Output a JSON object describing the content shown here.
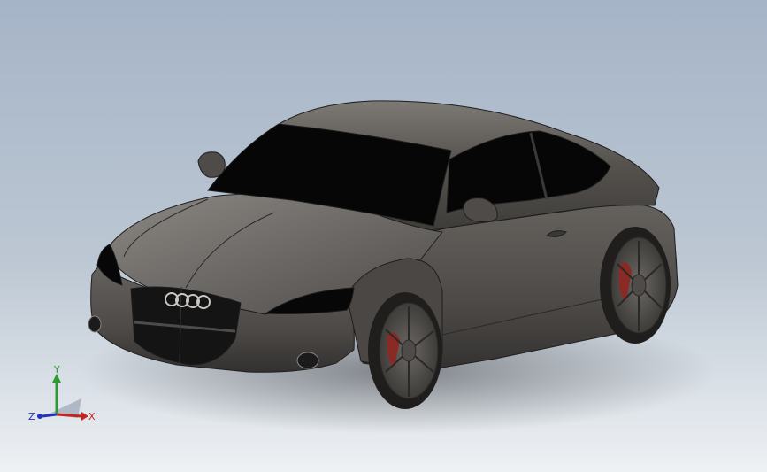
{
  "viewport": {
    "background_top": "#a5b4c7",
    "background_bottom": "#eef1f4"
  },
  "model": {
    "body_color": "#55524f",
    "glass_color": "#060606",
    "outline_color": "#1e1e1e",
    "brake_color": "#8b2a25",
    "logo_rings": 4
  },
  "triad": {
    "x_label": "X",
    "y_label": "Y",
    "z_label": "Z",
    "x_color": "#c4261e",
    "y_color": "#2f9a31",
    "z_color": "#2434b8"
  }
}
